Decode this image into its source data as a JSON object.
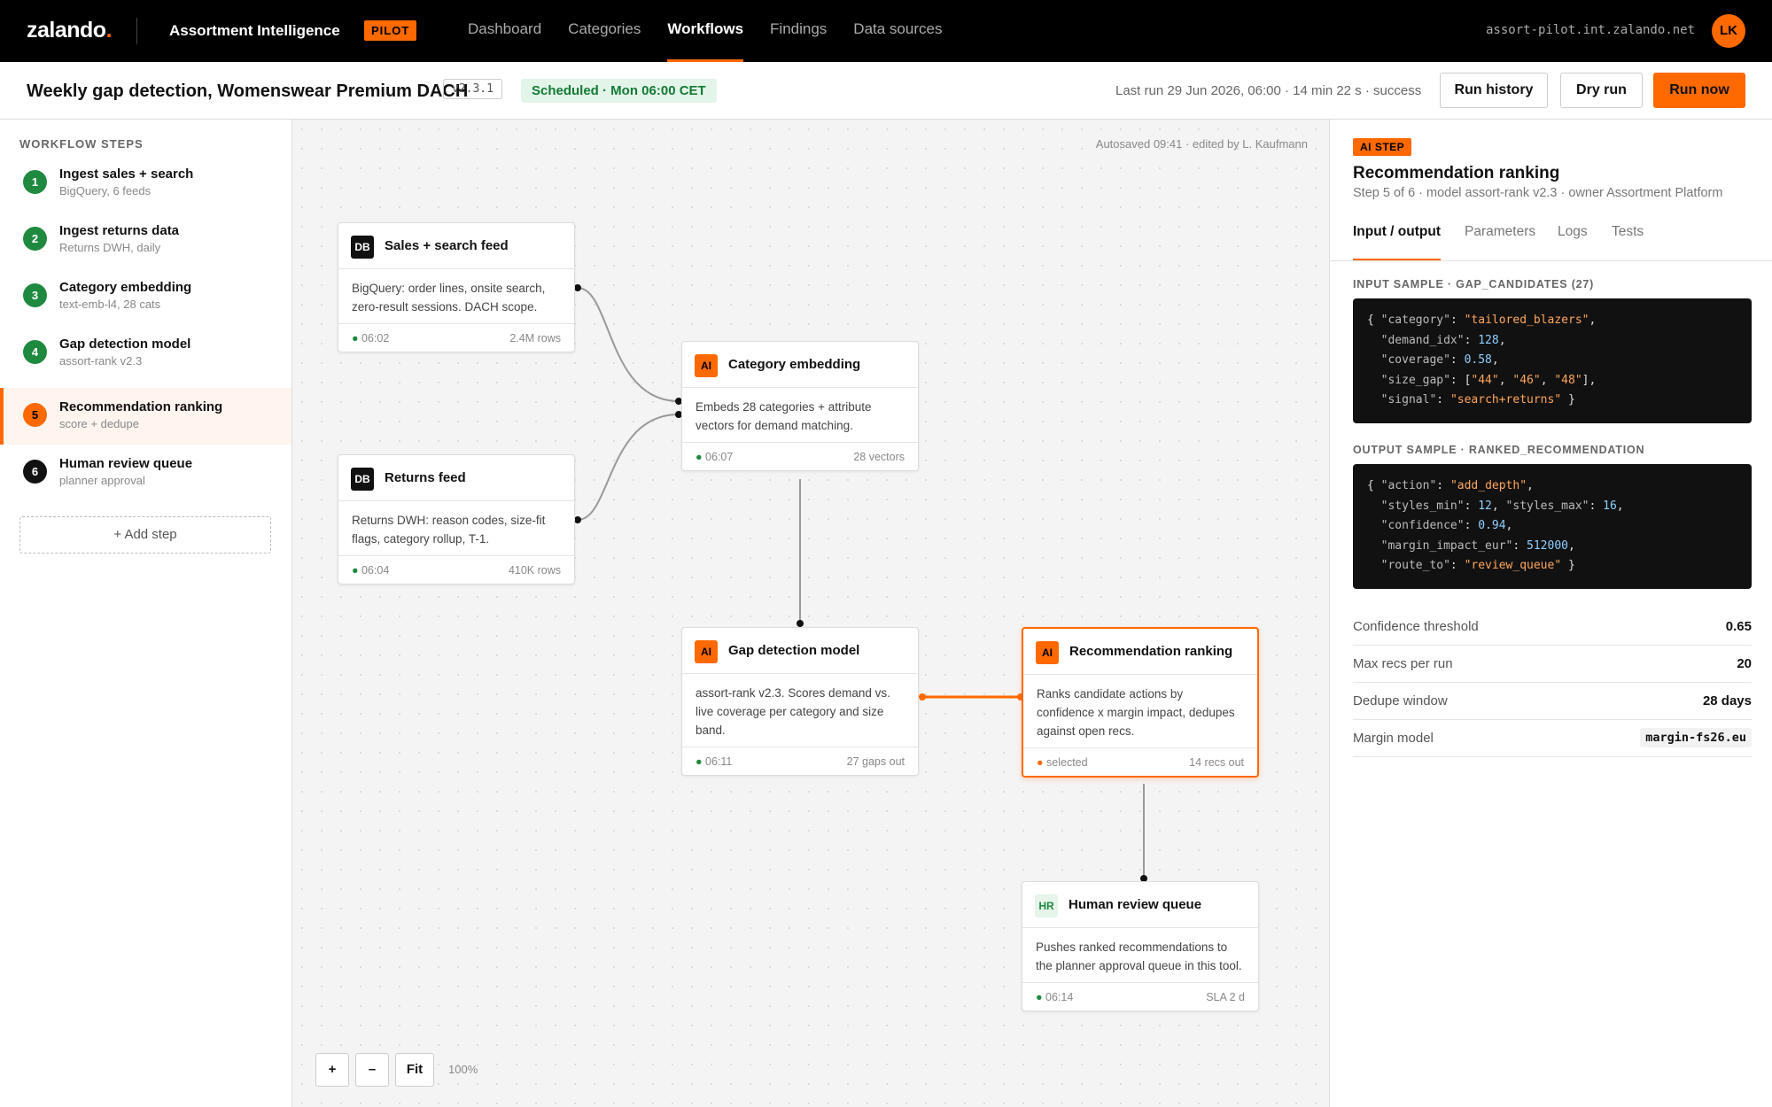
{
  "app": {
    "logo_text": "zalando",
    "logo_dot": ".",
    "name": "Assortment Intelligence",
    "badge": "PILOT",
    "host": "assort-pilot.int.zalando.net",
    "user_initials": "LK",
    "accent_color": "#ff6900"
  },
  "nav": {
    "items": [
      "Dashboard",
      "Categories",
      "Workflows",
      "Findings",
      "Data sources"
    ],
    "active": "Workflows"
  },
  "workflow": {
    "title": "Weekly gap detection, Womenswear Premium DACH",
    "version": "v2.3.1",
    "schedule": "Scheduled · Mon 06:00 CET",
    "last_run": "Last run 29 Jun 2026, 06:00 · 14 min 22 s · success",
    "buttons": {
      "history": "Run history",
      "dry": "Dry run",
      "run": "Run now"
    }
  },
  "sidebar": {
    "heading": "WORKFLOW STEPS",
    "steps": [
      {
        "num": "1",
        "title": "Ingest sales + search",
        "sub": "BigQuery, 6 feeds"
      },
      {
        "num": "2",
        "title": "Ingest returns data",
        "sub": "Returns DWH, daily"
      },
      {
        "num": "3",
        "title": "Category embedding",
        "sub": "text-emb-l4, 28 cats"
      },
      {
        "num": "4",
        "title": "Gap detection model",
        "sub": "assort-rank v2.3"
      },
      {
        "num": "5",
        "title": "Recommendation ranking",
        "sub": "score + dedupe"
      },
      {
        "num": "6",
        "title": "Human review queue",
        "sub": "planner approval"
      }
    ],
    "add_step": "+ Add step"
  },
  "canvas": {
    "autosave": "Autosaved 09:41 · edited by L. Kaufmann",
    "zoom": {
      "in": "+",
      "out": "–",
      "fit": "Fit",
      "level": "100%"
    },
    "nodes": [
      {
        "icon": "DB",
        "title": "Sales + search feed",
        "body": "BigQuery: order lines, onsite search, zero-result sessions. DACH scope.",
        "status": "06:02",
        "metric": "2.4M rows"
      },
      {
        "icon": "DB",
        "title": "Returns feed",
        "body": "Returns DWH: reason codes, size-fit flags, category rollup, T-1.",
        "status": "06:04",
        "metric": "410K rows"
      },
      {
        "icon": "AI",
        "title": "Category embedding",
        "body": "Embeds 28 categories + attribute vectors for demand matching.",
        "status": "06:07",
        "metric": "28 vectors"
      },
      {
        "icon": "AI",
        "title": "Gap detection model",
        "body": "assort-rank v2.3. Scores demand vs. live coverage per category and size band.",
        "status": "06:11",
        "metric": "27 gaps out"
      },
      {
        "icon": "AI",
        "title": "Recommendation ranking",
        "body": "Ranks candidate actions by confidence x margin impact, dedupes against open recs.",
        "status": "selected",
        "metric": "14 recs out"
      },
      {
        "icon": "HR",
        "title": "Human review queue",
        "body": "Pushes ranked recommendations to the planner approval queue in this tool.",
        "status": "06:14",
        "metric": "SLA 2 d"
      }
    ]
  },
  "panel": {
    "badge": "AI STEP",
    "title": "Recommendation ranking",
    "sub": "Step 5 of 6 · model assort-rank v2.3 · owner Assortment Platform",
    "tabs": [
      "Input / output",
      "Parameters",
      "Logs",
      "Tests"
    ],
    "active_tab": "Input / output",
    "input_label": "INPUT SAMPLE · GAP_CANDIDATES (27)",
    "input_code": [
      [
        {
          "t": "{ ",
          "c": "p"
        },
        {
          "t": "\"category\"",
          "c": "k"
        },
        {
          "t": ": ",
          "c": "p"
        },
        {
          "t": "\"tailored_blazers\"",
          "c": "s"
        },
        {
          "t": ",",
          "c": "p"
        }
      ],
      [
        {
          "t": "  \"demand_idx\"",
          "c": "k"
        },
        {
          "t": ": ",
          "c": "p"
        },
        {
          "t": "128",
          "c": "n"
        },
        {
          "t": ",",
          "c": "p"
        }
      ],
      [
        {
          "t": "  \"coverage\"",
          "c": "k"
        },
        {
          "t": ": ",
          "c": "p"
        },
        {
          "t": "0.58",
          "c": "n"
        },
        {
          "t": ",",
          "c": "p"
        }
      ],
      [
        {
          "t": "  \"size_gap\"",
          "c": "k"
        },
        {
          "t": ": [",
          "c": "p"
        },
        {
          "t": "\"44\"",
          "c": "s"
        },
        {
          "t": ", ",
          "c": "p"
        },
        {
          "t": "\"46\"",
          "c": "s"
        },
        {
          "t": ", ",
          "c": "p"
        },
        {
          "t": "\"48\"",
          "c": "s"
        },
        {
          "t": "],",
          "c": "p"
        }
      ],
      [
        {
          "t": "  \"signal\"",
          "c": "k"
        },
        {
          "t": ": ",
          "c": "p"
        },
        {
          "t": "\"search+returns\"",
          "c": "s"
        },
        {
          "t": " }",
          "c": "p"
        }
      ]
    ],
    "output_label": "OUTPUT SAMPLE · RANKED_RECOMMENDATION",
    "output_code": [
      [
        {
          "t": "{ ",
          "c": "p"
        },
        {
          "t": "\"action\"",
          "c": "k"
        },
        {
          "t": ": ",
          "c": "p"
        },
        {
          "t": "\"add_depth\"",
          "c": "s"
        },
        {
          "t": ",",
          "c": "p"
        }
      ],
      [
        {
          "t": "  \"styles_min\"",
          "c": "k"
        },
        {
          "t": ": ",
          "c": "p"
        },
        {
          "t": "12",
          "c": "n"
        },
        {
          "t": ", ",
          "c": "p"
        },
        {
          "t": "\"styles_max\"",
          "c": "k"
        },
        {
          "t": ": ",
          "c": "p"
        },
        {
          "t": "16",
          "c": "n"
        },
        {
          "t": ",",
          "c": "p"
        }
      ],
      [
        {
          "t": "  \"confidence\"",
          "c": "k"
        },
        {
          "t": ": ",
          "c": "p"
        },
        {
          "t": "0.94",
          "c": "n"
        },
        {
          "t": ",",
          "c": "p"
        }
      ],
      [
        {
          "t": "  \"margin_impact_eur\"",
          "c": "k"
        },
        {
          "t": ": ",
          "c": "p"
        },
        {
          "t": "512000",
          "c": "n"
        },
        {
          "t": ",",
          "c": "p"
        }
      ],
      [
        {
          "t": "  \"route_to\"",
          "c": "k"
        },
        {
          "t": ": ",
          "c": "p"
        },
        {
          "t": "\"review_queue\"",
          "c": "s"
        },
        {
          "t": " }",
          "c": "p"
        }
      ]
    ],
    "params": [
      {
        "label": "Confidence threshold",
        "value": "0.65"
      },
      {
        "label": "Max recs per run",
        "value": "20"
      },
      {
        "label": "Dedupe window",
        "value": "28 days"
      },
      {
        "label": "Margin model",
        "value": "margin-fs26.eu"
      }
    ]
  }
}
